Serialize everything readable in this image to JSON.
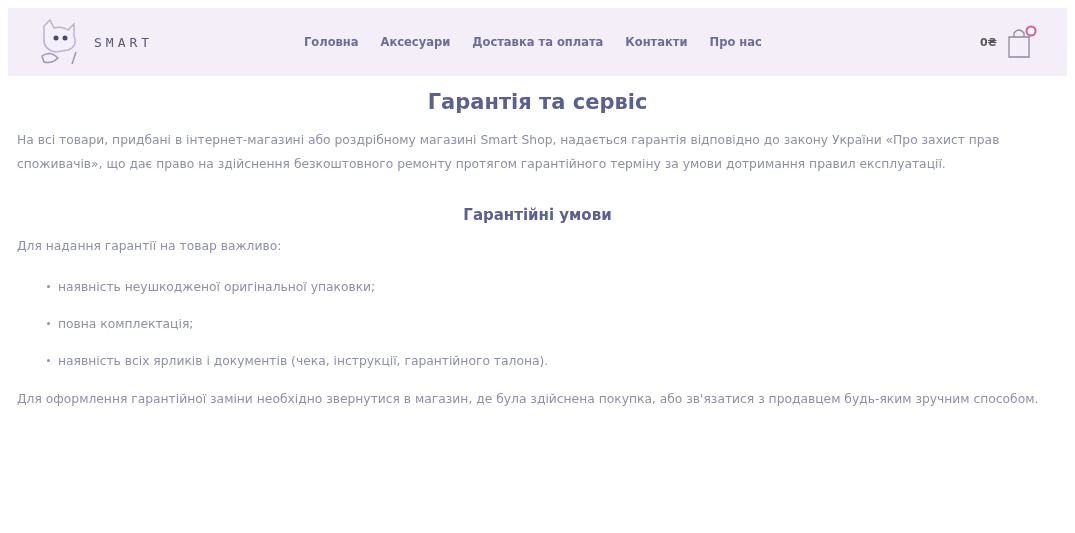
{
  "header": {
    "logo": {
      "text": "SMART"
    },
    "nav": [
      {
        "label": "Головна"
      },
      {
        "label": "Аксесуари"
      },
      {
        "label": "Доставка та оплата"
      },
      {
        "label": "Контакти"
      },
      {
        "label": "Про нас"
      }
    ],
    "cart": {
      "total": "0₴"
    }
  },
  "title": "Гарантія та сервіс",
  "intro": "На всі товари, придбані в інтернет-магазині або роздрібному магазині Smart Shop, надається гарантія відповідно до закону України «Про захист прав споживачів», що дає право на здійснення безкоштовного ремонту протягом гарантійного терміну за умови дотримання правил експлуатації.",
  "section": {
    "heading": "Гарантійні умови",
    "lead": "Для надання гарантії на товар важливо:",
    "items": [
      "наявність неушкодженої оригінальної упаковки;",
      "повна комплектація;",
      "наявність всіх ярликів і документів (чека, інструкції, гарантійного талона)."
    ],
    "outro": "Для оформлення гарантійної заміни необхідно звернутися в магазин, де була здійснена покупка, або зв'язатися з продавцем будь-яким зручним способом."
  }
}
